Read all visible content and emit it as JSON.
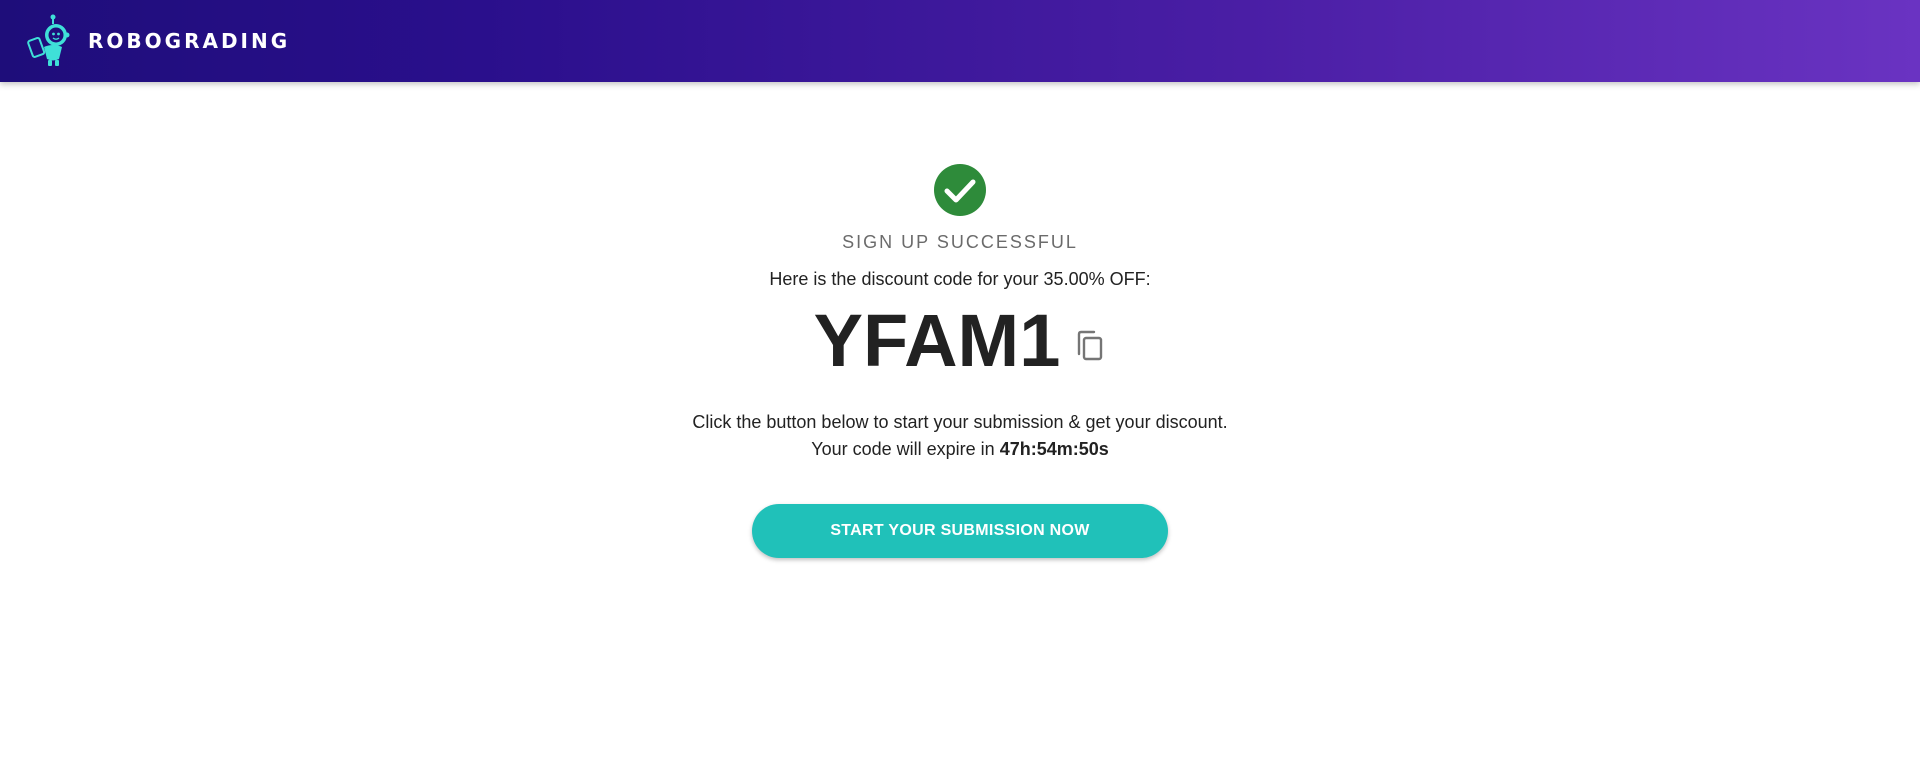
{
  "header": {
    "brand": "ROBOGRADING",
    "logo_icon": "robot-logo-icon",
    "background_start": "#1e0d7a",
    "background_end": "#6a33c2"
  },
  "main": {
    "success_icon": "check-circle-icon",
    "success_color": "#2e8b3a",
    "status_title": "SIGN UP SUCCESSFUL",
    "discount_intro": "Here is the discount code for your 35.00% OFF:",
    "code": "YFAM1",
    "copy_icon": "copy-icon",
    "instruction_line1": "Click the button below to start your submission & get your discount.",
    "expiry_prefix": "Your code will expire in",
    "expiry_value": "47h:54m:50s",
    "cta_label": "START YOUR SUBMISSION NOW",
    "cta_color": "#20c1b9"
  }
}
